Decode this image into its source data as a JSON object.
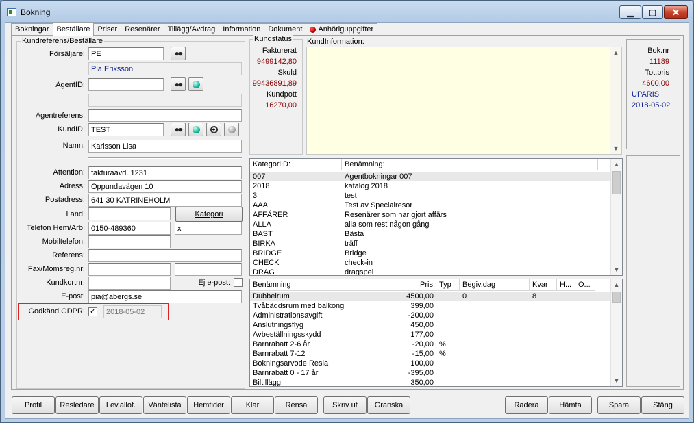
{
  "window": {
    "title": "Bokning"
  },
  "tabs": [
    {
      "label": "Bokningar",
      "active": false
    },
    {
      "label": "Beställare",
      "active": true
    },
    {
      "label": "Priser",
      "active": false
    },
    {
      "label": "Resenärer",
      "active": false
    },
    {
      "label": "Tillägg/Avdrag",
      "active": false
    },
    {
      "label": "Information",
      "active": false
    },
    {
      "label": "Dokument",
      "active": false
    },
    {
      "label": "Anhöriguppgifter",
      "active": false,
      "icon": "red-dot-icon"
    }
  ],
  "customer": {
    "group_title": "Kundreferens/Beställare",
    "seller_label": "Försäljare:",
    "seller_value": "PE",
    "seller_name": "Pia Eriksson",
    "agent_id_label": "AgentID:",
    "agent_id_value": "",
    "agent_name_value": "",
    "agent_ref_label": "Agentreferens:",
    "agent_ref_value": "",
    "customer_id_label": "KundID:",
    "customer_id_value": "TEST",
    "name_label": "Namn:",
    "name_value": "Karlsson Lisa",
    "attention_label": "Attention:",
    "attention_value": "fakturaavd. 1231",
    "address_label": "Adress:",
    "address_value": "Oppundavägen 10",
    "postal_label": "Postadress:",
    "postal_value": "641 30  KATRINEHOLM",
    "country_label": "Land:",
    "country_value": "",
    "category_button": "Kategori",
    "phone_label": "Telefon Hem/Arb:",
    "phone_home_value": "0150-489360",
    "phone_work_value": "x",
    "mobile_label": "Mobiltelefon:",
    "mobile_value": "",
    "reference_label": "Referens:",
    "reference_value": "",
    "fax_label": "Fax/Momsreg.nr:",
    "fax_value": "",
    "vat_value": "",
    "card_label": "Kundkortnr:",
    "card_value": "",
    "no_email_label": "Ej e-post:",
    "email_label": "E-post:",
    "email_value": "pia@abergs.se",
    "gdpr_label": "Godkänd GDPR:",
    "gdpr_checked": "✓",
    "gdpr_date": "2018-05-02"
  },
  "status": {
    "group_title": "Kundstatus",
    "invoiced_label": "Fakturerat",
    "invoiced_value": "9499142,80",
    "debt_label": "Skuld",
    "debt_value": "99436891,89",
    "pot_label": "Kundpott",
    "pot_value": "16270,00"
  },
  "info": {
    "title": "KundInformation:",
    "value": ""
  },
  "booking": {
    "no_label": "Bok.nr",
    "no_value": "11189",
    "total_label": "Tot.pris",
    "total_value": "4600,00",
    "code": "UPARIS",
    "date": "2018-05-02"
  },
  "categories": {
    "columns": [
      "KategoriID:",
      "Benämning:"
    ],
    "rows": [
      [
        "007",
        "Agentbokningar 007"
      ],
      [
        "2018",
        "katalog 2018"
      ],
      [
        "3",
        "test"
      ],
      [
        "AAA",
        "Test av Specialresor"
      ],
      [
        "AFFÄRER",
        "Resenärer som har gjort affärs"
      ],
      [
        "ALLA",
        "alla som rest någon gång"
      ],
      [
        "BAST",
        "Bästa"
      ],
      [
        "BIRKA",
        "träff"
      ],
      [
        "BRIDGE",
        "Bridge"
      ],
      [
        "CHECK",
        "check-in"
      ],
      [
        "DRAG",
        "dragspel"
      ]
    ]
  },
  "prices": {
    "columns": [
      "Benämning",
      "Pris",
      "Typ",
      "Begiv.dag",
      "Kvar",
      "H...",
      "O..."
    ],
    "rows": [
      [
        "Dubbelrum",
        "4500,00",
        "",
        "0",
        "8",
        "",
        ""
      ],
      [
        "Tvåbäddsrum med balkong",
        "399,00",
        "",
        "",
        "",
        "",
        ""
      ],
      [
        "Administrationsavgift",
        "-200,00",
        "",
        "",
        "",
        "",
        ""
      ],
      [
        "Anslutningsflyg",
        "450,00",
        "",
        "",
        "",
        "",
        ""
      ],
      [
        "Avbeställningsskydd",
        "177,00",
        "",
        "",
        "",
        "",
        ""
      ],
      [
        "Barnrabatt 2-6 år",
        "-20,00",
        "%",
        "",
        "",
        "",
        ""
      ],
      [
        "Barnrabatt 7-12",
        "-15,00",
        "%",
        "",
        "",
        "",
        ""
      ],
      [
        "Bokningsarvode Resia",
        "100,00",
        "",
        "",
        "",
        "",
        ""
      ],
      [
        "Barnrabatt 0 - 17 år",
        "-395,00",
        "",
        "",
        "",
        "",
        ""
      ],
      [
        "Biltillägg",
        "350,00",
        "",
        "",
        "",
        "",
        ""
      ]
    ]
  },
  "buttons": [
    "Profil",
    "Resledare",
    "Lev.allot.",
    "Väntelista",
    "Hemtider",
    "Klar",
    "Rensa",
    "Skriv ut",
    "Granska",
    "Radera",
    "Hämta",
    "Spara",
    "Stäng"
  ]
}
